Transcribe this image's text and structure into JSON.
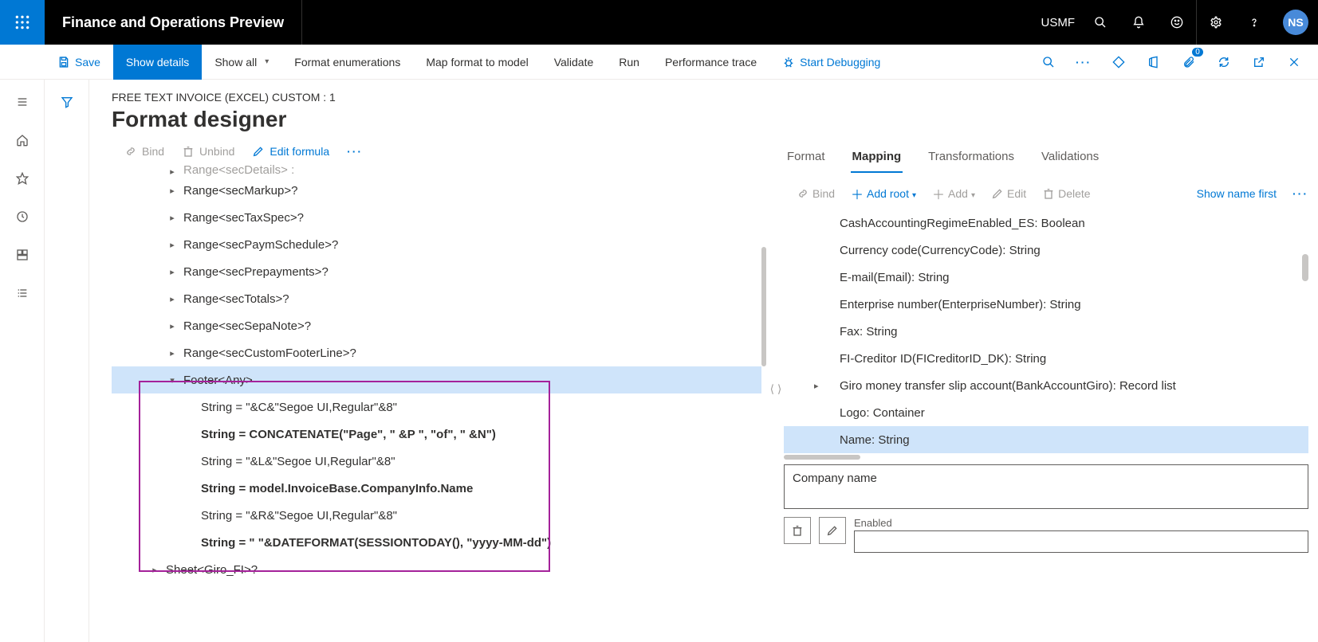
{
  "topbar": {
    "app_title": "Finance and Operations Preview",
    "company_code": "USMF",
    "user_initials": "NS"
  },
  "commandbar": {
    "save": "Save",
    "show_details": "Show details",
    "show_all": "Show all",
    "format_enum": "Format enumerations",
    "map_format": "Map format to model",
    "validate": "Validate",
    "run": "Run",
    "perf_trace": "Performance trace",
    "start_debug": "Start Debugging",
    "attach_badge": "0"
  },
  "header": {
    "breadcrumb": "FREE TEXT INVOICE (EXCEL) CUSTOM : 1",
    "title": "Format designer"
  },
  "tree_toolbar": {
    "bind": "Bind",
    "unbind": "Unbind",
    "edit_formula": "Edit formula"
  },
  "tree": {
    "items": [
      {
        "indent": 2,
        "tw": "▸",
        "label": "Range<secDetails> :",
        "bold": false,
        "sel": false,
        "clip": true
      },
      {
        "indent": 2,
        "tw": "▸",
        "label": "Range<secMarkup>?",
        "bold": false,
        "sel": false
      },
      {
        "indent": 2,
        "tw": "▸",
        "label": "Range<secTaxSpec>?",
        "bold": false,
        "sel": false
      },
      {
        "indent": 2,
        "tw": "▸",
        "label": "Range<secPaymSchedule>?",
        "bold": false,
        "sel": false
      },
      {
        "indent": 2,
        "tw": "▸",
        "label": "Range<secPrepayments>?",
        "bold": false,
        "sel": false
      },
      {
        "indent": 2,
        "tw": "▸",
        "label": "Range<secTotals>?",
        "bold": false,
        "sel": false
      },
      {
        "indent": 2,
        "tw": "▸",
        "label": "Range<secSepaNote>?",
        "bold": false,
        "sel": false
      },
      {
        "indent": 2,
        "tw": "▸",
        "label": "Range<secCustomFooterLine>?",
        "bold": false,
        "sel": false
      },
      {
        "indent": 2,
        "tw": "▾",
        "label": "Footer<Any>",
        "bold": false,
        "sel": true
      },
      {
        "indent": 3,
        "tw": "",
        "label": "String = \"&C&\"Segoe UI,Regular\"&8\"",
        "bold": false,
        "sel": false
      },
      {
        "indent": 3,
        "tw": "",
        "label": "String = CONCATENATE(\"Page\", \" &P \", \"of\", \" &N\")",
        "bold": true,
        "sel": false
      },
      {
        "indent": 3,
        "tw": "",
        "label": "String = \"&L&\"Segoe UI,Regular\"&8\"",
        "bold": false,
        "sel": false
      },
      {
        "indent": 3,
        "tw": "",
        "label": "String = model.InvoiceBase.CompanyInfo.Name",
        "bold": true,
        "sel": false
      },
      {
        "indent": 3,
        "tw": "",
        "label": "String = \"&R&\"Segoe UI,Regular\"&8\"",
        "bold": false,
        "sel": false
      },
      {
        "indent": 3,
        "tw": "",
        "label": "String = \" \"&DATEFORMAT(SESSIONTODAY(), \"yyyy-MM-dd\")",
        "bold": true,
        "sel": false
      },
      {
        "indent": 1,
        "tw": "▸",
        "label": "Sheet<Giro_FI>?",
        "bold": false,
        "sel": false
      }
    ]
  },
  "right_tabs": {
    "format": "Format",
    "mapping": "Mapping",
    "transformations": "Transformations",
    "validations": "Validations"
  },
  "map_toolbar": {
    "bind": "Bind",
    "add_root": "Add root",
    "add": "Add",
    "edit": "Edit",
    "delete": "Delete",
    "show_name_first": "Show name first"
  },
  "map_list": {
    "items": [
      {
        "label": "CashAccountingRegimeEnabled_ES: Boolean",
        "tw": "",
        "sel": false
      },
      {
        "label": "Currency code(CurrencyCode): String",
        "tw": "",
        "sel": false
      },
      {
        "label": "E-mail(Email): String",
        "tw": "",
        "sel": false
      },
      {
        "label": "Enterprise number(EnterpriseNumber): String",
        "tw": "",
        "sel": false
      },
      {
        "label": "Fax: String",
        "tw": "",
        "sel": false
      },
      {
        "label": "FI-Creditor ID(FICreditorID_DK): String",
        "tw": "",
        "sel": false
      },
      {
        "label": "Giro money transfer slip account(BankAccountGiro): Record list",
        "tw": "▸",
        "sel": false
      },
      {
        "label": "Logo: Container",
        "tw": "",
        "sel": false
      },
      {
        "label": "Name: String",
        "tw": "",
        "sel": true
      }
    ]
  },
  "detail": {
    "company_name_label": "Company name",
    "enabled_label": "Enabled"
  }
}
